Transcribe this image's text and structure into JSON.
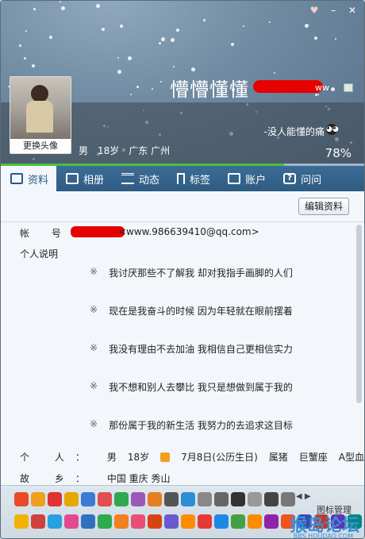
{
  "window": {
    "controls": {
      "skin": "♥",
      "minimize": "–",
      "close": "✕"
    }
  },
  "profile": {
    "avatar_button": "更换头像",
    "nickname": "懵懵懂懂",
    "nick_tail": "ww",
    "signature": "-没人能懂的痛",
    "gender": "男",
    "age": "18岁",
    "location": "广东 广州",
    "completion": "78%",
    "completion_value": 0.78
  },
  "tabs": [
    {
      "label": "资料",
      "icon": "profile-card-icon"
    },
    {
      "label": "相册",
      "icon": "photo-icon"
    },
    {
      "label": "动态",
      "icon": "feed-icon"
    },
    {
      "label": "标签",
      "icon": "tag-icon"
    },
    {
      "label": "账户",
      "icon": "wallet-icon"
    },
    {
      "label": "问问",
      "icon": "question-icon"
    }
  ],
  "content": {
    "edit_button": "编辑资料",
    "account_label": "帐 号：",
    "account_value": "<www.986639410@qq.com>",
    "intro_label": "个人说明",
    "mottos": [
      {
        "mark": "※",
        "text": "我讨厌那些不了解我 却对我指手画脚的人们"
      },
      {
        "mark": "※",
        "text": "现在是我奋斗的时候 因为年轻就在眼前摆着"
      },
      {
        "mark": "※",
        "text": "我没有理由不去加油 我相信自己更相信实力"
      },
      {
        "mark": "※",
        "text": "我不想和别人去攀比 我只是想做到属于我的"
      },
      {
        "mark": "※",
        "text": "那份属于我的新生活 我努力的去追求这目标"
      }
    ],
    "personal": {
      "label": "个 人：",
      "gender": "男",
      "age": "18岁",
      "birthday": "7月8日(公历生日)",
      "zodiac": "属猪",
      "constellation": "巨蟹座",
      "blood": "A型血"
    },
    "hometown": {
      "label": "故 乡：",
      "value": "中国 重庆 秀山"
    }
  },
  "iconbar": {
    "manage_label": "图标管理",
    "watermark": "猴岛论坛",
    "watermark_sub": "BBS.HOUDAO.COM",
    "row1_colors": [
      "#e84a2a",
      "#f0a020",
      "#d33",
      "#e6a800",
      "#3a7bd5",
      "#e05050",
      "#2fa84f",
      "#9b59b6",
      "#e67e22",
      "#555",
      "#2c8fd6",
      "#888",
      "#666",
      "#333",
      "#999",
      "#444",
      "#777"
    ],
    "row2_colors": [
      "#f0b400",
      "#d04040",
      "#2aa0e0",
      "#e04a90",
      "#3070c0",
      "#2fa84f",
      "#f08020",
      "#e94e77",
      "#d84315",
      "#6a5acd",
      "#ff8c00",
      "#e53935",
      "#1e88e5",
      "#43a047",
      "#fb8c00",
      "#8e24aa",
      "#f4511e",
      "#3949ab",
      "#c0392b",
      "#5e35b1",
      "#00897b"
    ]
  }
}
